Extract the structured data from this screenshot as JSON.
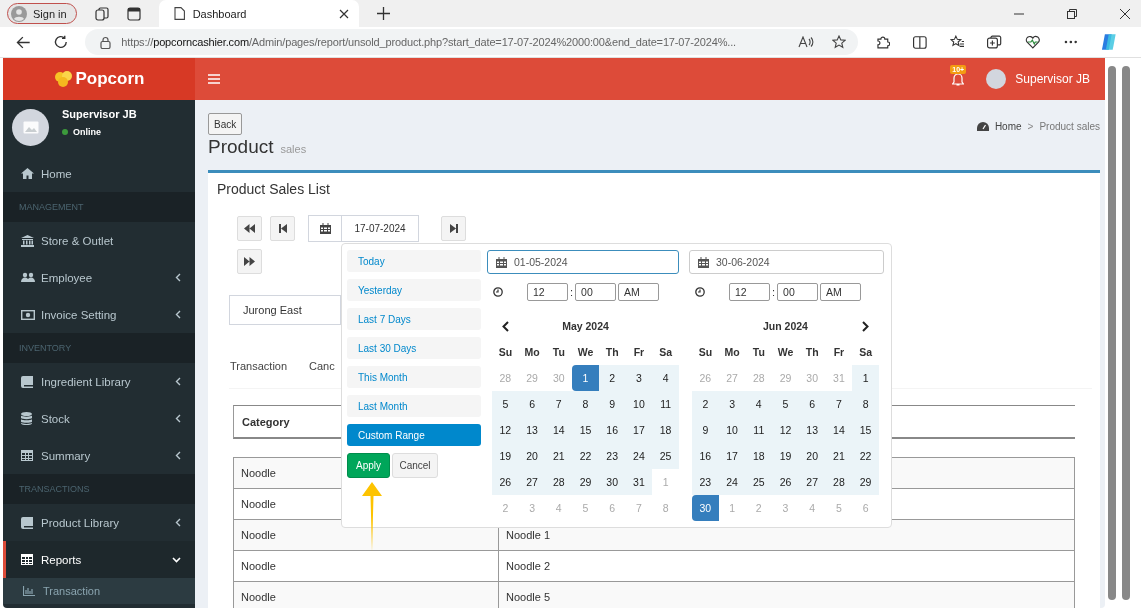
{
  "browser": {
    "sign_in": "Sign in",
    "tab": {
      "title": "Dashboard"
    },
    "url": {
      "scheme": "https://",
      "host": "popcorncashier.com",
      "path": "/Admin/pages/report/unsold_product.php?start_date=17-07-2024%2000:00&end_date=17-07-2024%..."
    }
  },
  "header": {
    "logo": "Popcorn",
    "notification_badge": "10+",
    "user": "Supervisor JB"
  },
  "sidebar": {
    "user": {
      "name": "Supervisor JB",
      "status": "Online"
    },
    "items": [
      {
        "kind": "item",
        "label": "Home",
        "has_submenu": false,
        "expanded": false,
        "selected": false
      },
      {
        "kind": "header",
        "label": "MANAGEMENT"
      },
      {
        "kind": "item",
        "label": "Store & Outlet",
        "has_submenu": false,
        "expanded": false,
        "selected": false
      },
      {
        "kind": "item",
        "label": "Employee",
        "has_submenu": true,
        "expanded": false,
        "selected": false
      },
      {
        "kind": "item",
        "label": "Invoice Setting",
        "has_submenu": true,
        "expanded": false,
        "selected": false
      },
      {
        "kind": "header",
        "label": "INVENTORY"
      },
      {
        "kind": "item",
        "label": "Ingredient Library",
        "has_submenu": true,
        "expanded": false,
        "selected": false
      },
      {
        "kind": "item",
        "label": "Stock",
        "has_submenu": true,
        "expanded": false,
        "selected": false
      },
      {
        "kind": "item",
        "label": "Summary",
        "has_submenu": true,
        "expanded": false,
        "selected": false
      },
      {
        "kind": "header",
        "label": "TRANSACTIONS"
      },
      {
        "kind": "item",
        "label": "Product Library",
        "has_submenu": true,
        "expanded": false,
        "selected": false
      },
      {
        "kind": "item",
        "label": "Reports",
        "has_submenu": true,
        "expanded": true,
        "selected": true,
        "children": [
          {
            "label": "Transaction"
          }
        ]
      }
    ]
  },
  "page": {
    "back": "Back",
    "title": "Product",
    "subtitle": "sales",
    "breadcrumb": [
      {
        "kind": "link",
        "label": "Home"
      },
      {
        "kind": "separator",
        "label": ">"
      },
      {
        "kind": "current",
        "label": "Product sales"
      }
    ]
  },
  "box": {
    "title": "Product Sales List",
    "date": "17-07-2024",
    "outlet": "Jurong East",
    "tabs": [
      {
        "label": "Transaction",
        "selected": false
      },
      {
        "label": "Canc",
        "selected": false
      }
    ],
    "table": {
      "columns": [
        "Category"
      ],
      "rows": [
        {
          "category": "Noodle"
        },
        {
          "category": "Noodle"
        },
        {
          "category": "Noodle",
          "product": "Noodle 1"
        },
        {
          "category": "Noodle",
          "product": "Noodle 2"
        },
        {
          "category": "Noodle",
          "product": "Noodle 5"
        }
      ]
    }
  },
  "datepicker": {
    "ranges": [
      {
        "label": "Today",
        "selected": false
      },
      {
        "label": "Yesterday",
        "selected": false
      },
      {
        "label": "Last 7 Days",
        "selected": false
      },
      {
        "label": "Last 30 Days",
        "selected": false
      },
      {
        "label": "This Month",
        "selected": false
      },
      {
        "label": "Last Month",
        "selected": false
      },
      {
        "label": "Custom Range",
        "selected": true
      }
    ],
    "apply": "Apply",
    "cancel": "Cancel",
    "calendars": [
      {
        "date": "01-05-2024",
        "focused": true,
        "hour": "12",
        "separator": ":",
        "minute": "00",
        "ampm": "AM",
        "month": "May 2024",
        "weekdays": [
          "Su",
          "Mo",
          "Tu",
          "We",
          "Th",
          "Fr",
          "Sa"
        ],
        "days": [
          {
            "d": "28",
            "kind": "other",
            "selected": false
          },
          {
            "d": "29",
            "kind": "other",
            "selected": false
          },
          {
            "d": "30",
            "kind": "other",
            "selected": false
          },
          {
            "d": "1",
            "kind": "range",
            "selected": true
          },
          {
            "d": "2",
            "kind": "range",
            "selected": false
          },
          {
            "d": "3",
            "kind": "range",
            "selected": false
          },
          {
            "d": "4",
            "kind": "range",
            "selected": false
          },
          {
            "d": "5",
            "kind": "range",
            "selected": false
          },
          {
            "d": "6",
            "kind": "range",
            "selected": false
          },
          {
            "d": "7",
            "kind": "range",
            "selected": false
          },
          {
            "d": "8",
            "kind": "range",
            "selected": false
          },
          {
            "d": "9",
            "kind": "range",
            "selected": false
          },
          {
            "d": "10",
            "kind": "range",
            "selected": false
          },
          {
            "d": "11",
            "kind": "range",
            "selected": false
          },
          {
            "d": "12",
            "kind": "range",
            "selected": false
          },
          {
            "d": "13",
            "kind": "range",
            "selected": false
          },
          {
            "d": "14",
            "kind": "range",
            "selected": false
          },
          {
            "d": "15",
            "kind": "range",
            "selected": false
          },
          {
            "d": "16",
            "kind": "range",
            "selected": false
          },
          {
            "d": "17",
            "kind": "range",
            "selected": false
          },
          {
            "d": "18",
            "kind": "range",
            "selected": false
          },
          {
            "d": "19",
            "kind": "range",
            "selected": false
          },
          {
            "d": "20",
            "kind": "range",
            "selected": false
          },
          {
            "d": "21",
            "kind": "range",
            "selected": false
          },
          {
            "d": "22",
            "kind": "range",
            "selected": false
          },
          {
            "d": "23",
            "kind": "range",
            "selected": false
          },
          {
            "d": "24",
            "kind": "range",
            "selected": false
          },
          {
            "d": "25",
            "kind": "range",
            "selected": false
          },
          {
            "d": "26",
            "kind": "range",
            "selected": false
          },
          {
            "d": "27",
            "kind": "range",
            "selected": false
          },
          {
            "d": "28",
            "kind": "range",
            "selected": false
          },
          {
            "d": "29",
            "kind": "range",
            "selected": false
          },
          {
            "d": "30",
            "kind": "range",
            "selected": false
          },
          {
            "d": "31",
            "kind": "range",
            "selected": false
          },
          {
            "d": "1",
            "kind": "other",
            "selected": false
          },
          {
            "d": "2",
            "kind": "other",
            "selected": false
          },
          {
            "d": "3",
            "kind": "other",
            "selected": false
          },
          {
            "d": "4",
            "kind": "other",
            "selected": false
          },
          {
            "d": "5",
            "kind": "other",
            "selected": false
          },
          {
            "d": "6",
            "kind": "other",
            "selected": false
          },
          {
            "d": "7",
            "kind": "other",
            "selected": false
          },
          {
            "d": "8",
            "kind": "other",
            "selected": false
          }
        ]
      },
      {
        "date": "30-06-2024",
        "focused": false,
        "hour": "12",
        "separator": ":",
        "minute": "00",
        "ampm": "AM",
        "month": "Jun 2024",
        "weekdays": [
          "Su",
          "Mo",
          "Tu",
          "We",
          "Th",
          "Fr",
          "Sa"
        ],
        "days": [
          {
            "d": "26",
            "kind": "other",
            "selected": false
          },
          {
            "d": "27",
            "kind": "other",
            "selected": false
          },
          {
            "d": "28",
            "kind": "other",
            "selected": false
          },
          {
            "d": "29",
            "kind": "other",
            "selected": false
          },
          {
            "d": "30",
            "kind": "other",
            "selected": false
          },
          {
            "d": "31",
            "kind": "other",
            "selected": false
          },
          {
            "d": "1",
            "kind": "range",
            "selected": false
          },
          {
            "d": "2",
            "kind": "range",
            "selected": false
          },
          {
            "d": "3",
            "kind": "range",
            "selected": false
          },
          {
            "d": "4",
            "kind": "range",
            "selected": false
          },
          {
            "d": "5",
            "kind": "range",
            "selected": false
          },
          {
            "d": "6",
            "kind": "range",
            "selected": false
          },
          {
            "d": "7",
            "kind": "range",
            "selected": false
          },
          {
            "d": "8",
            "kind": "range",
            "selected": false
          },
          {
            "d": "9",
            "kind": "range",
            "selected": false
          },
          {
            "d": "10",
            "kind": "range",
            "selected": false
          },
          {
            "d": "11",
            "kind": "range",
            "selected": false
          },
          {
            "d": "12",
            "kind": "range",
            "selected": false
          },
          {
            "d": "13",
            "kind": "range",
            "selected": false
          },
          {
            "d": "14",
            "kind": "range",
            "selected": false
          },
          {
            "d": "15",
            "kind": "range",
            "selected": false
          },
          {
            "d": "16",
            "kind": "range",
            "selected": false
          },
          {
            "d": "17",
            "kind": "range",
            "selected": false
          },
          {
            "d": "18",
            "kind": "range",
            "selected": false
          },
          {
            "d": "19",
            "kind": "range",
            "selected": false
          },
          {
            "d": "20",
            "kind": "range",
            "selected": false
          },
          {
            "d": "21",
            "kind": "range",
            "selected": false
          },
          {
            "d": "22",
            "kind": "range",
            "selected": false
          },
          {
            "d": "23",
            "kind": "range",
            "selected": false
          },
          {
            "d": "24",
            "kind": "range",
            "selected": false
          },
          {
            "d": "25",
            "kind": "range",
            "selected": false
          },
          {
            "d": "26",
            "kind": "range",
            "selected": false
          },
          {
            "d": "27",
            "kind": "range",
            "selected": false
          },
          {
            "d": "28",
            "kind": "range",
            "selected": false
          },
          {
            "d": "29",
            "kind": "range",
            "selected": false
          },
          {
            "d": "30",
            "kind": "range",
            "selected": true
          },
          {
            "d": "1",
            "kind": "other",
            "selected": false
          },
          {
            "d": "2",
            "kind": "other",
            "selected": false
          },
          {
            "d": "3",
            "kind": "other",
            "selected": false
          },
          {
            "d": "4",
            "kind": "other",
            "selected": false
          },
          {
            "d": "5",
            "kind": "other",
            "selected": false
          },
          {
            "d": "6",
            "kind": "other",
            "selected": false
          }
        ]
      }
    ]
  }
}
